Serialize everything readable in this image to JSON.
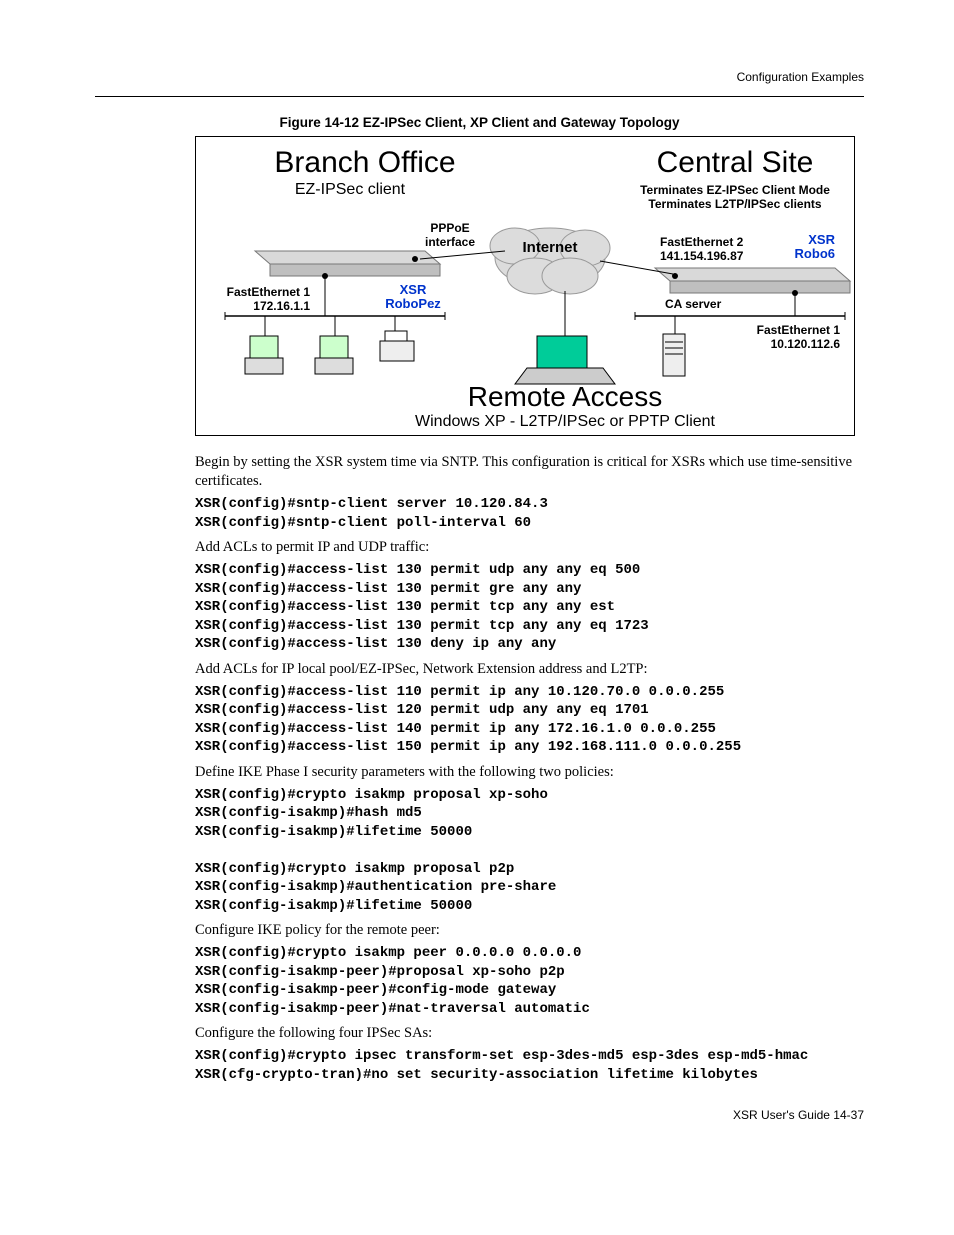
{
  "header": {
    "right": "Configuration Examples"
  },
  "figure": {
    "caption": "Figure 14-12    EZ-IPSec Client, XP Client and Gateway Topology",
    "labels": {
      "branch_office": "Branch Office",
      "central_site": "Central Site",
      "ez_ipsec_client": "EZ-IPSec client",
      "term1": "Terminates EZ-IPSec Client Mode",
      "term2": "Terminates L2TP/IPSec clients",
      "pppoe": "PPPoE",
      "interface": "interface",
      "internet": "Internet",
      "fe2": "FastEthernet 2",
      "fe2_ip": "141.154.196.87",
      "xsr_left": "XSR",
      "xsr_right": "XSR",
      "robopez": "RoboPez",
      "robo6": "Robo6",
      "fe1_left": "FastEthernet 1",
      "fe1_left_ip": "172.16.1.1",
      "ca_server": "CA server",
      "fe1_right": "FastEthernet 1",
      "fe1_right_ip": "10.120.112.6",
      "remote_access": "Remote Access",
      "winxp": "Windows XP - L2TP/IPSec or PPTP Client"
    }
  },
  "body": {
    "p1": "Begin by setting the XSR system time via SNTP. This configuration is critical for XSRs which use time-sensitive certificates.",
    "c1": "XSR(config)#sntp-client server 10.120.84.3\nXSR(config)#sntp-client poll-interval 60",
    "p2": "Add ACLs to permit IP and UDP traffic:",
    "c2": "XSR(config)#access-list 130 permit udp any any eq 500\nXSR(config)#access-list 130 permit gre any any\nXSR(config)#access-list 130 permit tcp any any est\nXSR(config)#access-list 130 permit tcp any any eq 1723\nXSR(config)#access-list 130 deny ip any any",
    "p3": "Add ACLs for IP local pool/EZ-IPSec, Network Extension address and L2TP:",
    "c3": "XSR(config)#access-list 110 permit ip any 10.120.70.0 0.0.0.255\nXSR(config)#access-list 120 permit udp any any eq 1701\nXSR(config)#access-list 140 permit ip any 172.16.1.0 0.0.0.255\nXSR(config)#access-list 150 permit ip any 192.168.111.0 0.0.0.255",
    "p4": "Define IKE Phase I security parameters with the following two policies:",
    "c4": "XSR(config)#crypto isakmp proposal xp-soho\nXSR(config-isakmp)#hash md5\nXSR(config-isakmp)#lifetime 50000\n\nXSR(config)#crypto isakmp proposal p2p\nXSR(config-isakmp)#authentication pre-share\nXSR(config-isakmp)#lifetime 50000",
    "p5": "Configure IKE policy for the remote peer:",
    "c5": "XSR(config)#crypto isakmp peer 0.0.0.0 0.0.0.0\nXSR(config-isakmp-peer)#proposal xp-soho p2p\nXSR(config-isakmp-peer)#config-mode gateway\nXSR(config-isakmp-peer)#nat-traversal automatic",
    "p6": "Configure the following four IPSec SAs:",
    "c6": "XSR(config)#crypto ipsec transform-set esp-3des-md5 esp-3des esp-md5-hmac\nXSR(cfg-crypto-tran)#no set security-association lifetime kilobytes"
  },
  "footer": {
    "text": "XSR User's Guide    14-37"
  }
}
